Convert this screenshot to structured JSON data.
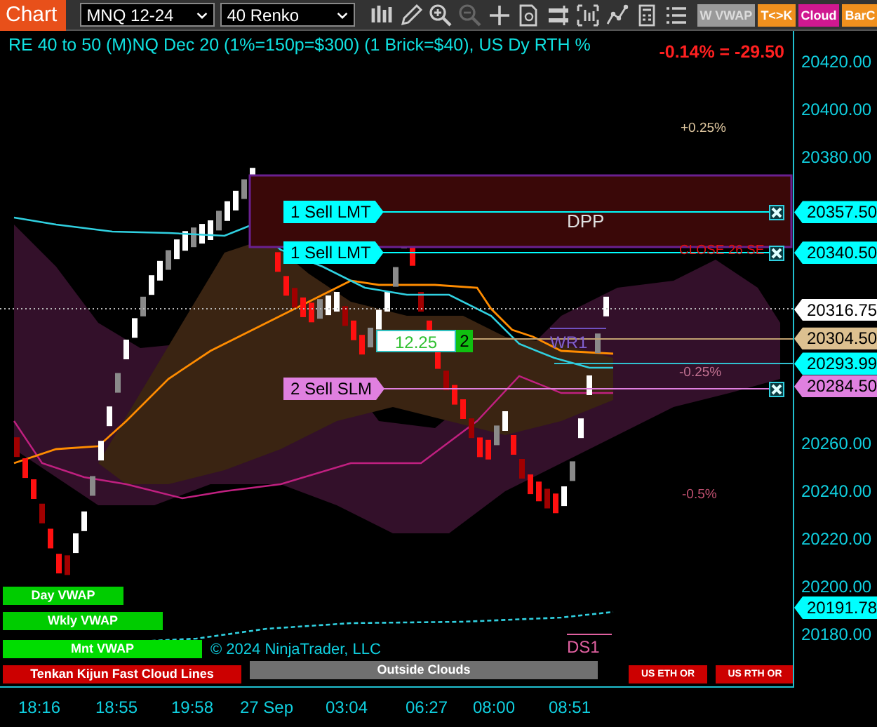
{
  "toolbar": {
    "tab": "Chart",
    "instrument": "MNQ 12-24",
    "bar_type": "40 Renko",
    "tools": [
      {
        "disabled": false
      },
      {
        "disabled": false
      },
      {
        "disabled": false
      },
      {
        "disabled": true
      },
      {
        "disabled": false
      },
      {
        "disabled": false
      },
      {
        "disabled": false
      },
      {
        "disabled": false
      },
      {
        "disabled": false
      },
      {
        "disabled": false
      },
      {
        "disabled": false
      }
    ],
    "buttons": [
      {
        "label": "W VWAP",
        "on": false
      },
      {
        "label": "T<>K",
        "on": true,
        "color": "#f0901e"
      },
      {
        "label": "Cloud",
        "on": true,
        "color": "#d01890"
      },
      {
        "label": "BarC",
        "on": true,
        "color": "#f0901e"
      }
    ]
  },
  "chart": {
    "title": "RE 40 to 50 (M)NQ Dec 20 (1%=150p=$300) (1 Brick=$40), US Dy RTH %",
    "change": "-0.14% = -29.50",
    "price_ticks": [
      "20420.00",
      "20400.00",
      "20380.00",
      "20260.00",
      "20240.00",
      "20220.00",
      "20200.00",
      "20180.00"
    ],
    "price_tags": [
      {
        "value": "20357.50",
        "color": "#00ffff"
      },
      {
        "value": "20340.50",
        "color": "#00ffff"
      },
      {
        "value": "20316.75",
        "color": "#ffffff"
      },
      {
        "value": "20304.50",
        "color": "#dcc090"
      },
      {
        "value": "20293.99",
        "color": "#00ffff"
      },
      {
        "value": "20284.50",
        "color": "#e080e0"
      },
      {
        "value": "20191.78",
        "color": "#00ffff"
      }
    ],
    "time_ticks": [
      "18:16",
      "18:55",
      "19:58",
      "27 Sep",
      "03:04",
      "06:27",
      "08:00",
      "08:51"
    ],
    "zone": {
      "label": "DPP"
    },
    "level_labels": [
      {
        "text": "+0.25%",
        "color": "#e0c8a0"
      },
      {
        "text": "-0.25%",
        "color": "#c07090"
      },
      {
        "text": "-0.5%",
        "color": "#c05070"
      }
    ],
    "orders": [
      {
        "label": "1 Sell LMT",
        "color": "#00ffff"
      },
      {
        "label": "1 Sell LMT",
        "color": "#00ffff"
      },
      {
        "label": "2 Sell SLM",
        "color": "#e080e0"
      }
    ],
    "position": {
      "pnl": "12.25",
      "quantity": "2"
    },
    "markers": [
      {
        "text": "CLOSE 26 SE",
        "color": "#e01010"
      },
      {
        "text": "WR1",
        "color": "#8060d0"
      },
      {
        "text": "DS1",
        "color": "#e060a0"
      }
    ],
    "indicator_labels": [
      {
        "label": "Day VWAP",
        "color": "#00cc00"
      },
      {
        "label": "Wkly VWAP",
        "color": "#00cc00"
      },
      {
        "label": "Mnt VWAP",
        "color": "#00dd00"
      },
      {
        "label": "Tenkan Kijun Fast Cloud Lines",
        "color": "#cc0000"
      },
      {
        "label": "Outside Clouds",
        "color": "#707070"
      },
      {
        "label": "US ETH OR",
        "color": "#cc0000"
      },
      {
        "label": "US RTH OR",
        "color": "#cc0000"
      }
    ],
    "copyright": "© 2024 NinjaTrader, LLC"
  }
}
